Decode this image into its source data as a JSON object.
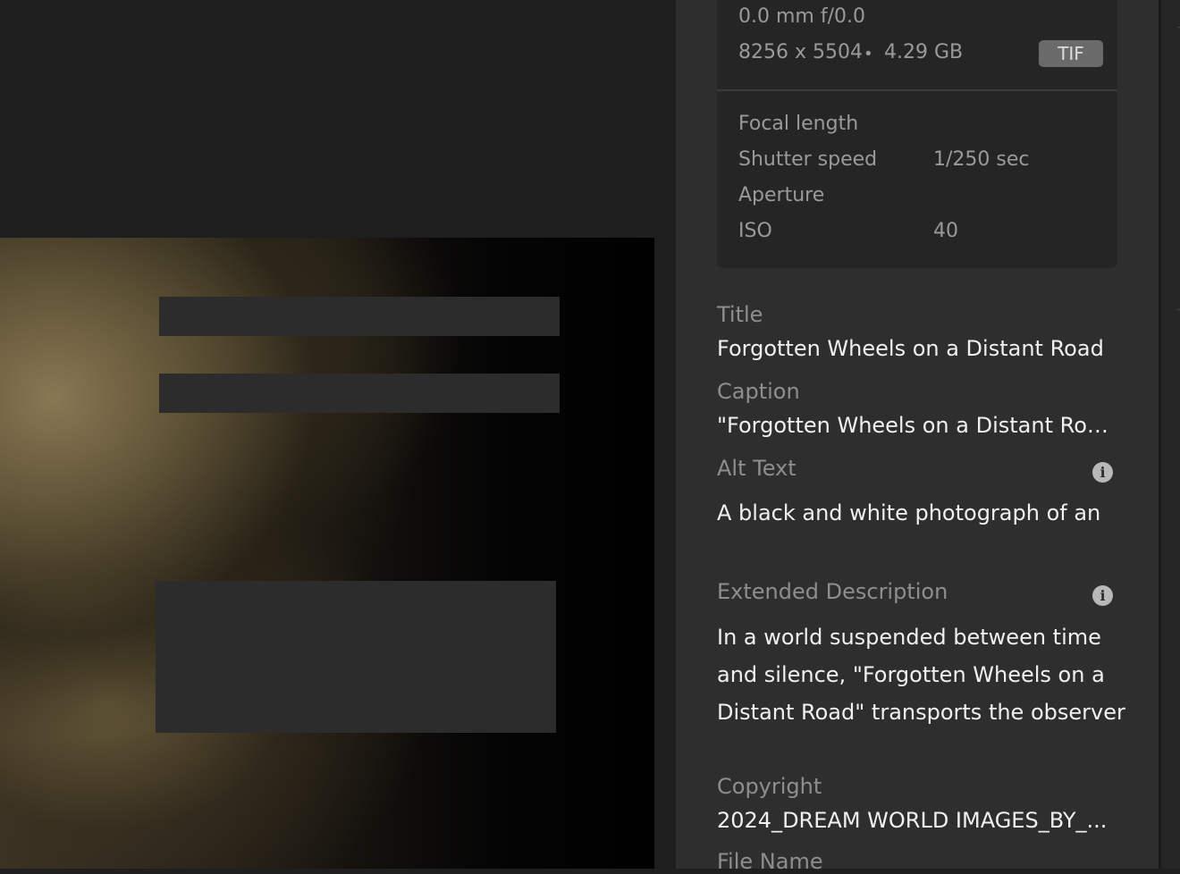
{
  "photo_info": {
    "lens": "0.0 mm f/0.0",
    "dimensions": "8256 x 5504",
    "separator": "•",
    "file_size": "4.29 GB",
    "format_badge": "TIF"
  },
  "exif": [
    {
      "label": "Focal length",
      "value": ""
    },
    {
      "label": "Shutter speed",
      "value": "1/250 sec"
    },
    {
      "label": "Aperture",
      "value": ""
    },
    {
      "label": "ISO",
      "value": "40"
    }
  ],
  "metadata": {
    "title_label": "Title",
    "title_value": "Forgotten Wheels on a Distant Road",
    "caption_label": "Caption",
    "caption_value": "\"Forgotten Wheels on a Distant Road...",
    "alt_text_label": "Alt Text",
    "alt_text_value": "A black and white photograph of an",
    "extended_description_label": "Extended Description",
    "extended_description_lines": [
      "In a world suspended between time",
      "and silence, \"Forgotten Wheels on a",
      "Distant Road\" transports the observer"
    ],
    "copyright_label": "Copyright",
    "copyright_value": "2024_DREAM WORLD IMAGES_BY_...",
    "file_name_label": "File Name"
  },
  "icons": {
    "info": "info-icon"
  }
}
